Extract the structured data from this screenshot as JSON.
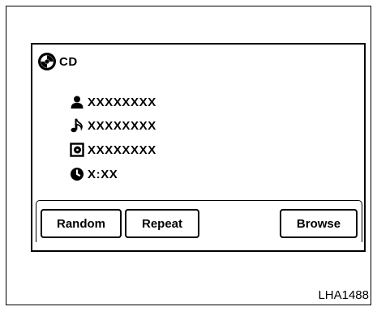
{
  "source": {
    "icon": "cd-disc-icon",
    "label": "CD"
  },
  "track_info": [
    {
      "icon": "artist-person-icon",
      "text": "XXXXXXXX"
    },
    {
      "icon": "music-note-icon",
      "text": "XXXXXXXX"
    },
    {
      "icon": "album-disc-box-icon",
      "text": "XXXXXXXX"
    },
    {
      "icon": "clock-icon",
      "text": "X:XX"
    }
  ],
  "buttons": {
    "random_label": "Random",
    "repeat_label": "Repeat",
    "browse_label": "Browse"
  },
  "figure_code": "LHA1488"
}
